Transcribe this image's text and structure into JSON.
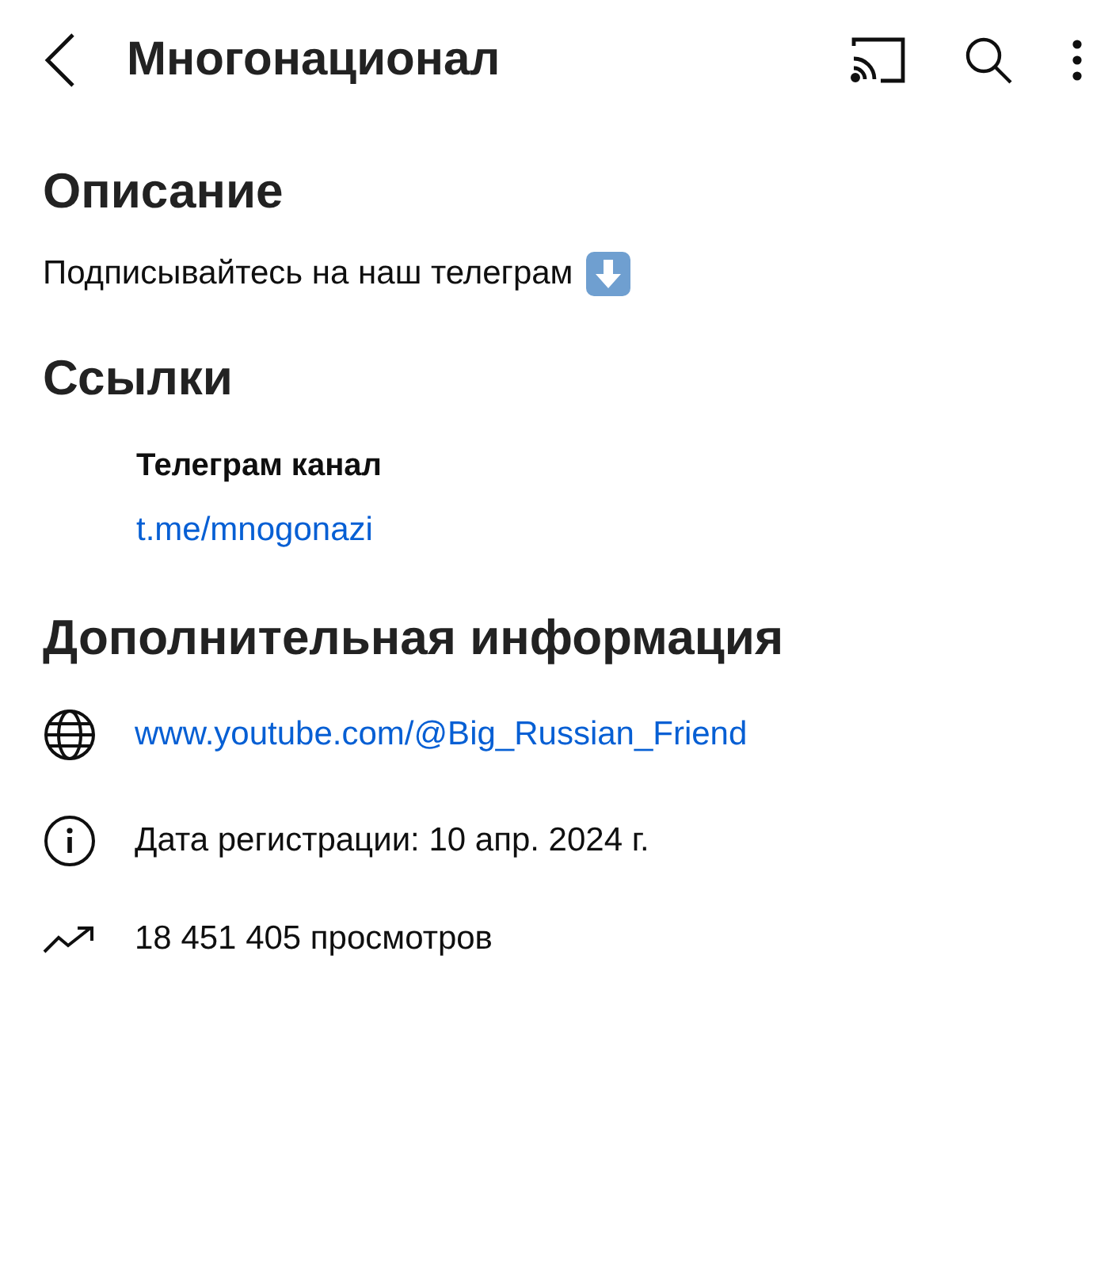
{
  "header": {
    "title": "Многонационал"
  },
  "description": {
    "heading": "Описание",
    "text": "Подписывайтесь на наш телеграм"
  },
  "links": {
    "heading": "Ссылки",
    "items": [
      {
        "title": "Телеграм канал",
        "url": "t.me/mnogonazi"
      }
    ]
  },
  "more_info": {
    "heading": "Дополнительная информация",
    "rows": [
      {
        "kind": "website",
        "text": "www.youtube.com/@Big_Russian_Friend"
      },
      {
        "kind": "joined",
        "text": "Дата регистрации: 10 апр. 2024 г."
      },
      {
        "kind": "views",
        "text": "18 451 405 просмотров"
      }
    ]
  }
}
